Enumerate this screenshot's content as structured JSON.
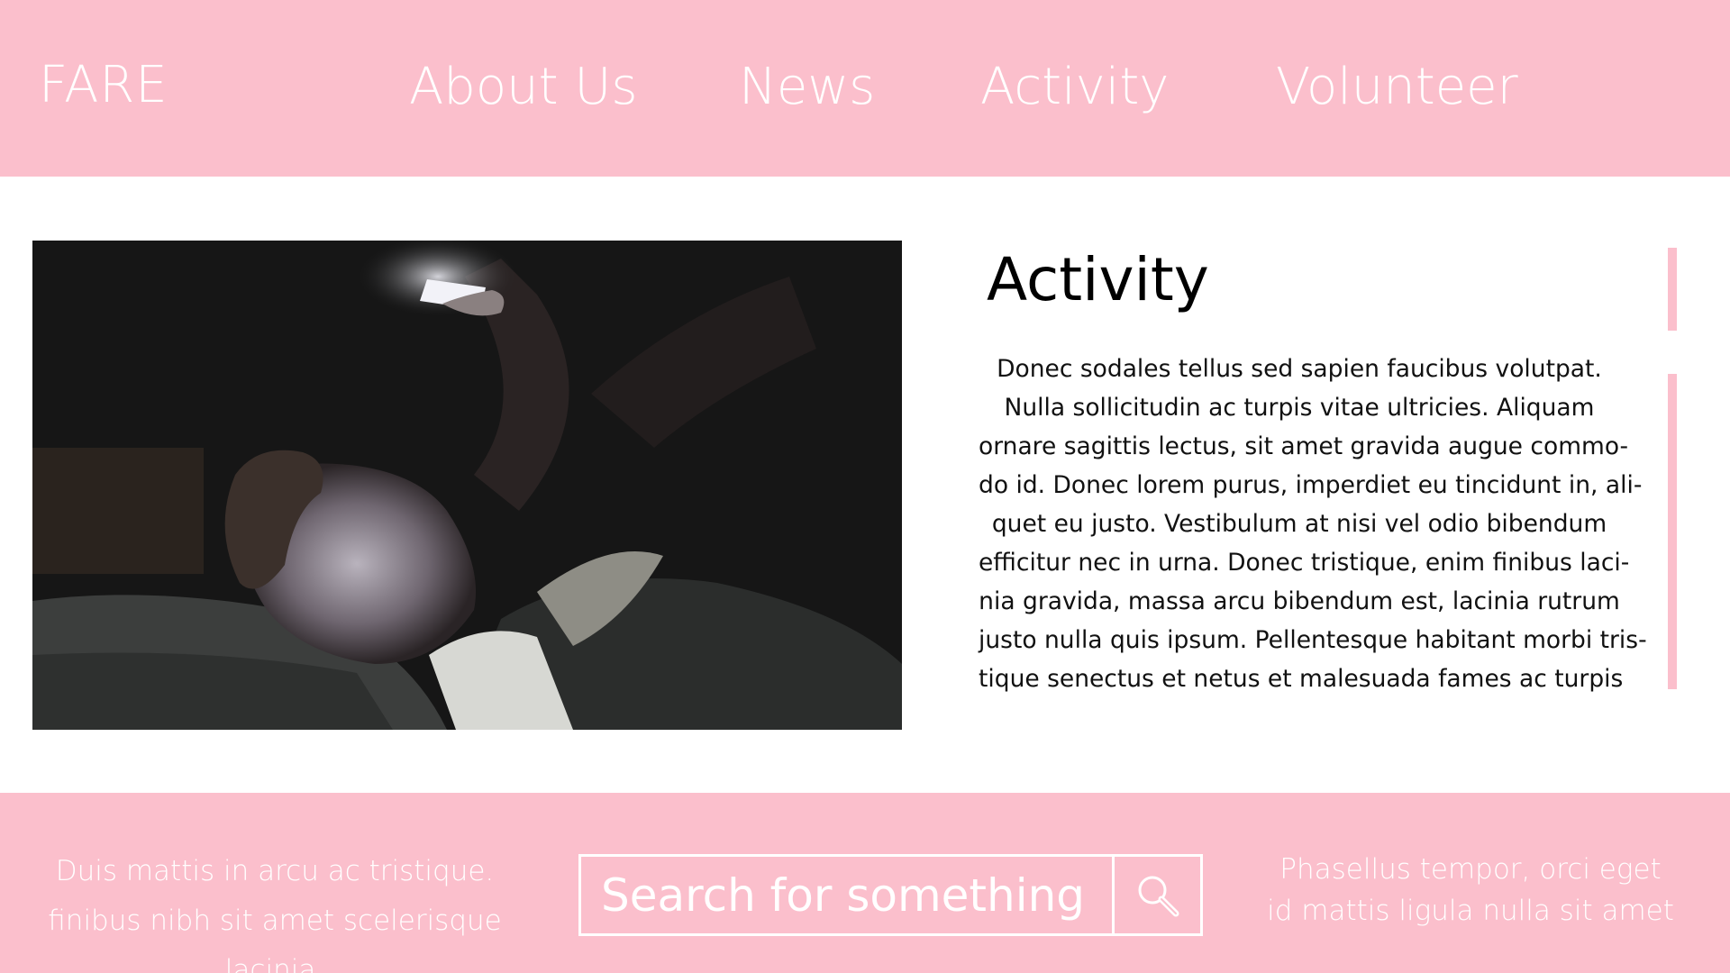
{
  "header": {
    "logo": "FARE",
    "nav": [
      "About Us",
      "News",
      "Activity",
      "Volunteer"
    ]
  },
  "main": {
    "image_alt": "person lying in bed lit by phone screen",
    "title": "Activity",
    "body_lines": [
      "Donec sodales tellus sed sapien faucibus volutpat.",
      "Nulla sollicitudin ac turpis vitae ultricies. Aliquam",
      "ornare sagittis lectus, sit amet gravida augue commo-",
      "do id. Donec lorem purus, imperdiet eu tincidunt in, ali-",
      "quet eu justo. Vestibulum at nisi vel odio bibendum",
      "efficitur nec in urna. Donec tristique, enim finibus laci-",
      "nia gravida, massa arcu bibendum est, lacinia rutrum",
      "justo nulla quis ipsum. Pellentesque habitant morbi tris-",
      "tique senectus et netus et malesuada fames ac turpis"
    ]
  },
  "footer": {
    "left_lines": [
      "Duis mattis in arcu ac tristique.",
      "finibus nibh sit amet scelerisque lacinia."
    ],
    "search_placeholder": "Search for something",
    "search_icon": "magnifier-icon",
    "right_lines": [
      "Phasellus tempor, orci eget",
      "id mattis ligula nulla sit amet"
    ]
  },
  "colors": {
    "accent": "#fbbfcc",
    "text_on_accent": "#ffffff"
  }
}
